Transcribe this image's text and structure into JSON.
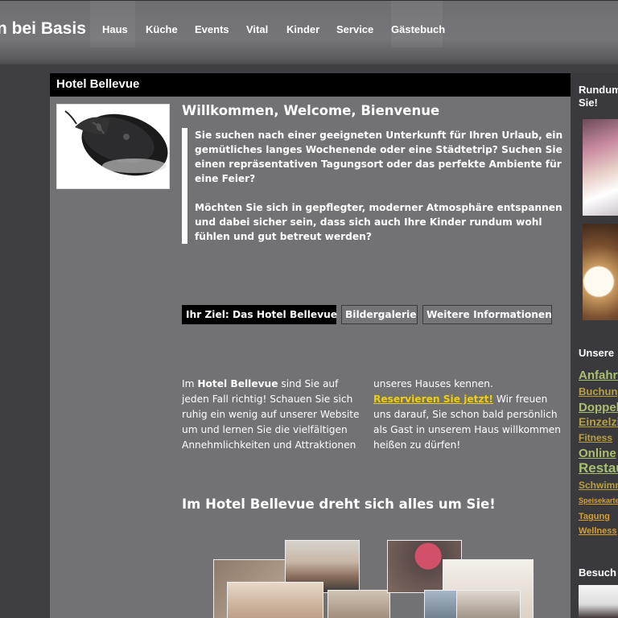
{
  "header": {
    "brand": "n bei Basis",
    "nav": [
      "Haus",
      "Küche",
      "Events",
      "Vital",
      "Kinder",
      "Service",
      "Gästebuch"
    ]
  },
  "main": {
    "title": "Hotel Bellevue",
    "welcome_title": "Willkommen, Welcome, Bienvenue",
    "intro_1": "Sie suchen nach einer geeigneten Unterkunft für Ihren Urlaub, ein gemütliches langes Wochenende oder eine Städtetrip? Suchen Sie einen repräsentativen Tagungsort oder das perfekte Ambiente für eine Feier?",
    "intro_2": "Möchten Sie sich in gepflegter, moderner Atmosphäre entspannen und dabei sicher sein, dass sich auch Ihre Kinder rundum wohl fühlen und gut betreut werden?",
    "tabs": [
      "Ihr Ziel: Das Hotel Bellevue",
      "Bildergalerie",
      "Weitere Informationen"
    ],
    "body_left_pre": "Im ",
    "body_left_bold": "Hotel Bellevue",
    "body_left_post": " sind Sie auf jeden Fall richtig! Schauen Sie sich ruhig ein wenig auf unserer Website um und lernen Sie die vielfältigen Annehmlichkeiten und Attraktionen",
    "body_right_pre": "unseres Hauses kennen.",
    "reserve_link": "Reservieren Sie jetzt!",
    "body_right_post": " Wir freuen uns darauf, Sie schon bald persönlich als Gast in unserem Haus willkommen heißen zu dürfen!",
    "subheading": "Im Hotel Bellevue dreht sich alles um Sie!"
  },
  "sidebar": {
    "title_1_line1": "Rundum",
    "title_1_line2": "Sie!",
    "title_2": "Unsere",
    "links": [
      {
        "text": "Anfahrt",
        "color": "#a8c070",
        "size": 15
      },
      {
        "text": "Buchung",
        "color": "#b8a040",
        "size": 13
      },
      {
        "text": "Doppelzimmer",
        "color": "#a8c070",
        "size": 15
      },
      {
        "text": "Einzelzimmer",
        "color": "#b8a040",
        "size": 14
      },
      {
        "text": "Fitness",
        "color": "#b8a040",
        "size": 12
      },
      {
        "text": "Online",
        "color": "#a8c070",
        "size": 15
      },
      {
        "text": "Restaurant",
        "color": "#a8c070",
        "size": 17
      },
      {
        "text": "Schwimmbad",
        "color": "#b8a040",
        "size": 12
      },
      {
        "text": "Speisekarte",
        "color": "#d4a030",
        "size": 9
      },
      {
        "text": "Tagung",
        "color": "#d4a030",
        "size": 11
      },
      {
        "text": "Wellness",
        "color": "#d4a030",
        "size": 11
      }
    ],
    "title_3": "Besuch"
  }
}
